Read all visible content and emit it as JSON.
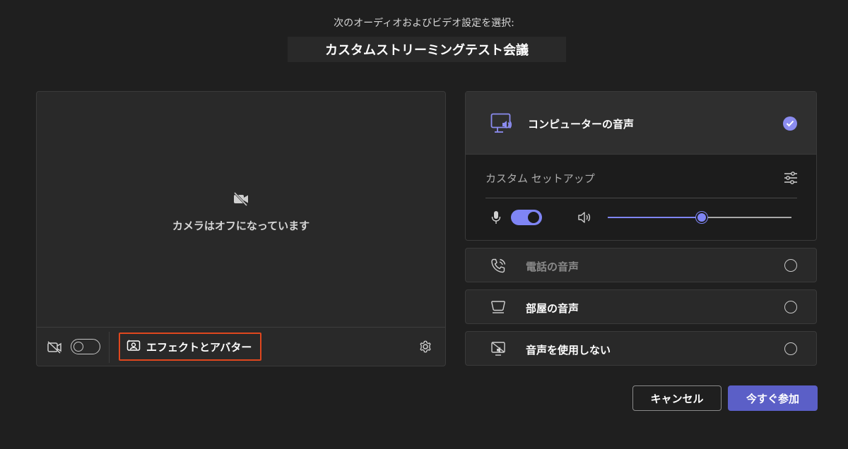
{
  "header": {
    "subtitle": "次のオーディオおよびビデオ設定を選択:",
    "meeting_title": "カスタムストリーミングテスト会議"
  },
  "video": {
    "camera_off_text": "カメラはオフになっています",
    "camera_toggle_on": false,
    "effects_label": "エフェクトとアバター"
  },
  "audio_options": {
    "computer": {
      "label": "コンピューターの音声",
      "selected": true,
      "custom_setup_label": "カスタム セットアップ",
      "mic_on": true,
      "speaker_volume": 0.51
    },
    "phone": {
      "label": "電話の音声",
      "selected": false,
      "disabled": true
    },
    "room": {
      "label": "部屋の音声",
      "selected": false
    },
    "none": {
      "label": "音声を使用しない",
      "selected": false
    }
  },
  "actions": {
    "cancel_label": "キャンセル",
    "join_label": "今すぐ参加"
  },
  "colors": {
    "accent": "#7f85f5",
    "primary_button": "#5b5fc7",
    "highlight_border": "#e0471e",
    "background": "#1f1f1f"
  },
  "icons": {
    "camera_off": "video-off-icon",
    "effects": "effects-avatar-icon",
    "settings": "gear-icon",
    "computer_audio": "computer-speaker-icon",
    "check": "checkmark-icon",
    "sliders": "sliders-icon",
    "mic": "microphone-icon",
    "speaker": "speaker-icon",
    "phone": "phone-icon",
    "room": "room-audio-icon",
    "no_audio": "no-audio-icon"
  }
}
